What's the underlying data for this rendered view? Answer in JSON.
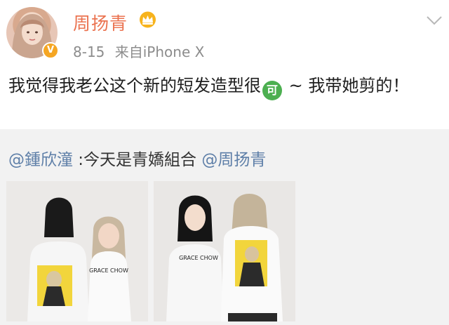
{
  "user": {
    "name": "周扬青",
    "verified_badge": "V",
    "crown_icon": "crown-icon"
  },
  "meta": {
    "date": "8-15",
    "source_prefix": "来自",
    "device": "iPhone X"
  },
  "post": {
    "text_before_emoji": "我觉得我老公这个新的短发造型很",
    "emoji_label": "可",
    "text_after_emoji": " ~ 我带她剪的！"
  },
  "repost": {
    "author_mention": "@鍾欣潼",
    "text": " :今天是青嬌組合 ",
    "tag_mention": "@周扬青"
  },
  "colors": {
    "username": "#eb7350",
    "mention": "#5e7fa8",
    "meta": "#8c8c8c",
    "repost_bg": "#f2f2f2"
  },
  "photos": {
    "shirt_text": "GRACE CHOW"
  }
}
